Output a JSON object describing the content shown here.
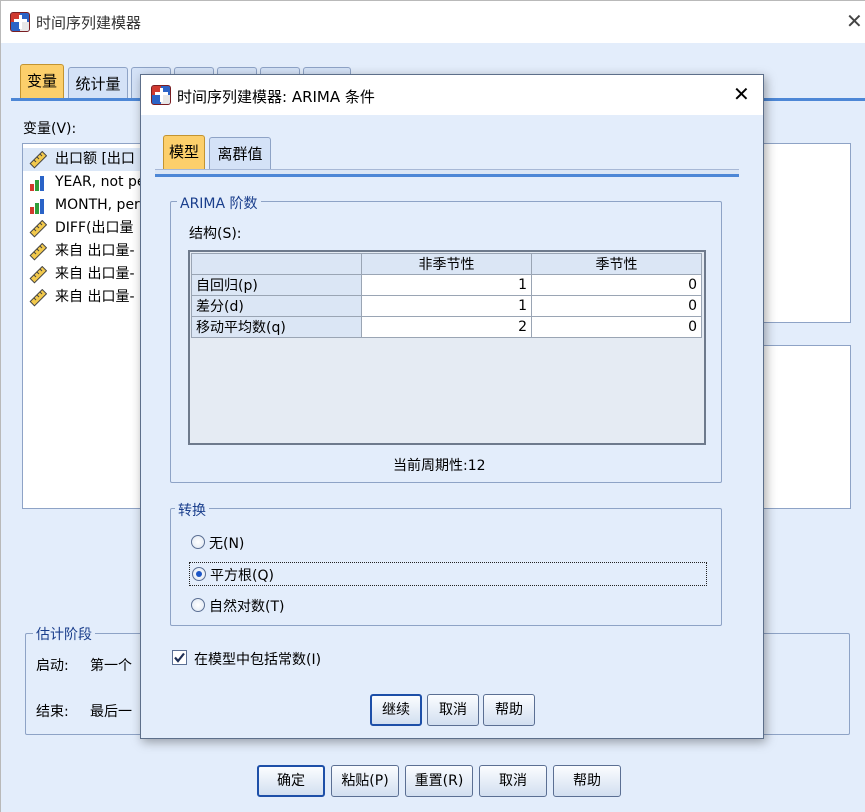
{
  "main_window": {
    "title": "时间序列建模器",
    "tabs": [
      "变量",
      "统计量",
      "",
      "",
      "",
      ""
    ],
    "variables_label": "变量(V):",
    "variables": [
      {
        "label": "出口额 [出口",
        "icon": "scale-ruler-icon"
      },
      {
        "label": "YEAR, not pe",
        "icon": "nominal-bars-icon"
      },
      {
        "label": "MONTH, per",
        "icon": "nominal-bars-icon"
      },
      {
        "label": "DIFF(出口量",
        "icon": "scale-ruler-icon"
      },
      {
        "label": "来自 出口量-",
        "icon": "scale-ruler-icon"
      },
      {
        "label": "来自 出口量-",
        "icon": "scale-ruler-icon"
      },
      {
        "label": "来自 出口量-",
        "icon": "scale-ruler-icon"
      }
    ],
    "estimation": {
      "group_label": "估计阶段",
      "start_label": "启动:",
      "start_value": "第一个",
      "end_label": "结束:",
      "end_value": "最后一"
    },
    "buttons": {
      "ok": "确定",
      "paste": "粘贴(P)",
      "reset": "重置(R)",
      "cancel": "取消",
      "help": "帮助"
    }
  },
  "dialog": {
    "title": "时间序列建模器: ARIMA 条件",
    "tabs": [
      "模型",
      "离群值"
    ],
    "arima_group_label": "ARIMA 阶数",
    "structure_label": "结构(S):",
    "table": {
      "columns": [
        "",
        "非季节性",
        "季节性"
      ],
      "rows": [
        {
          "label": "自回归(p)",
          "nonseasonal": "1",
          "seasonal": "0"
        },
        {
          "label": "差分(d)",
          "nonseasonal": "1",
          "seasonal": "0"
        },
        {
          "label": "移动平均数(q)",
          "nonseasonal": "2",
          "seasonal": "0"
        }
      ]
    },
    "periodicity": "当前周期性:12",
    "transform_group_label": "转换",
    "transform_options": [
      {
        "label": "无(N)",
        "checked": false
      },
      {
        "label": "平方根(Q)",
        "checked": true
      },
      {
        "label": "自然对数(T)",
        "checked": false
      }
    ],
    "include_constant_label": "在模型中包括常数(I)",
    "include_constant": true,
    "buttons": {
      "continue": "继续",
      "cancel": "取消",
      "help": "帮助"
    }
  },
  "colors": {
    "accent": "#fccf6b",
    "frame": "#e3edfb",
    "border": "#8ea3c6"
  }
}
